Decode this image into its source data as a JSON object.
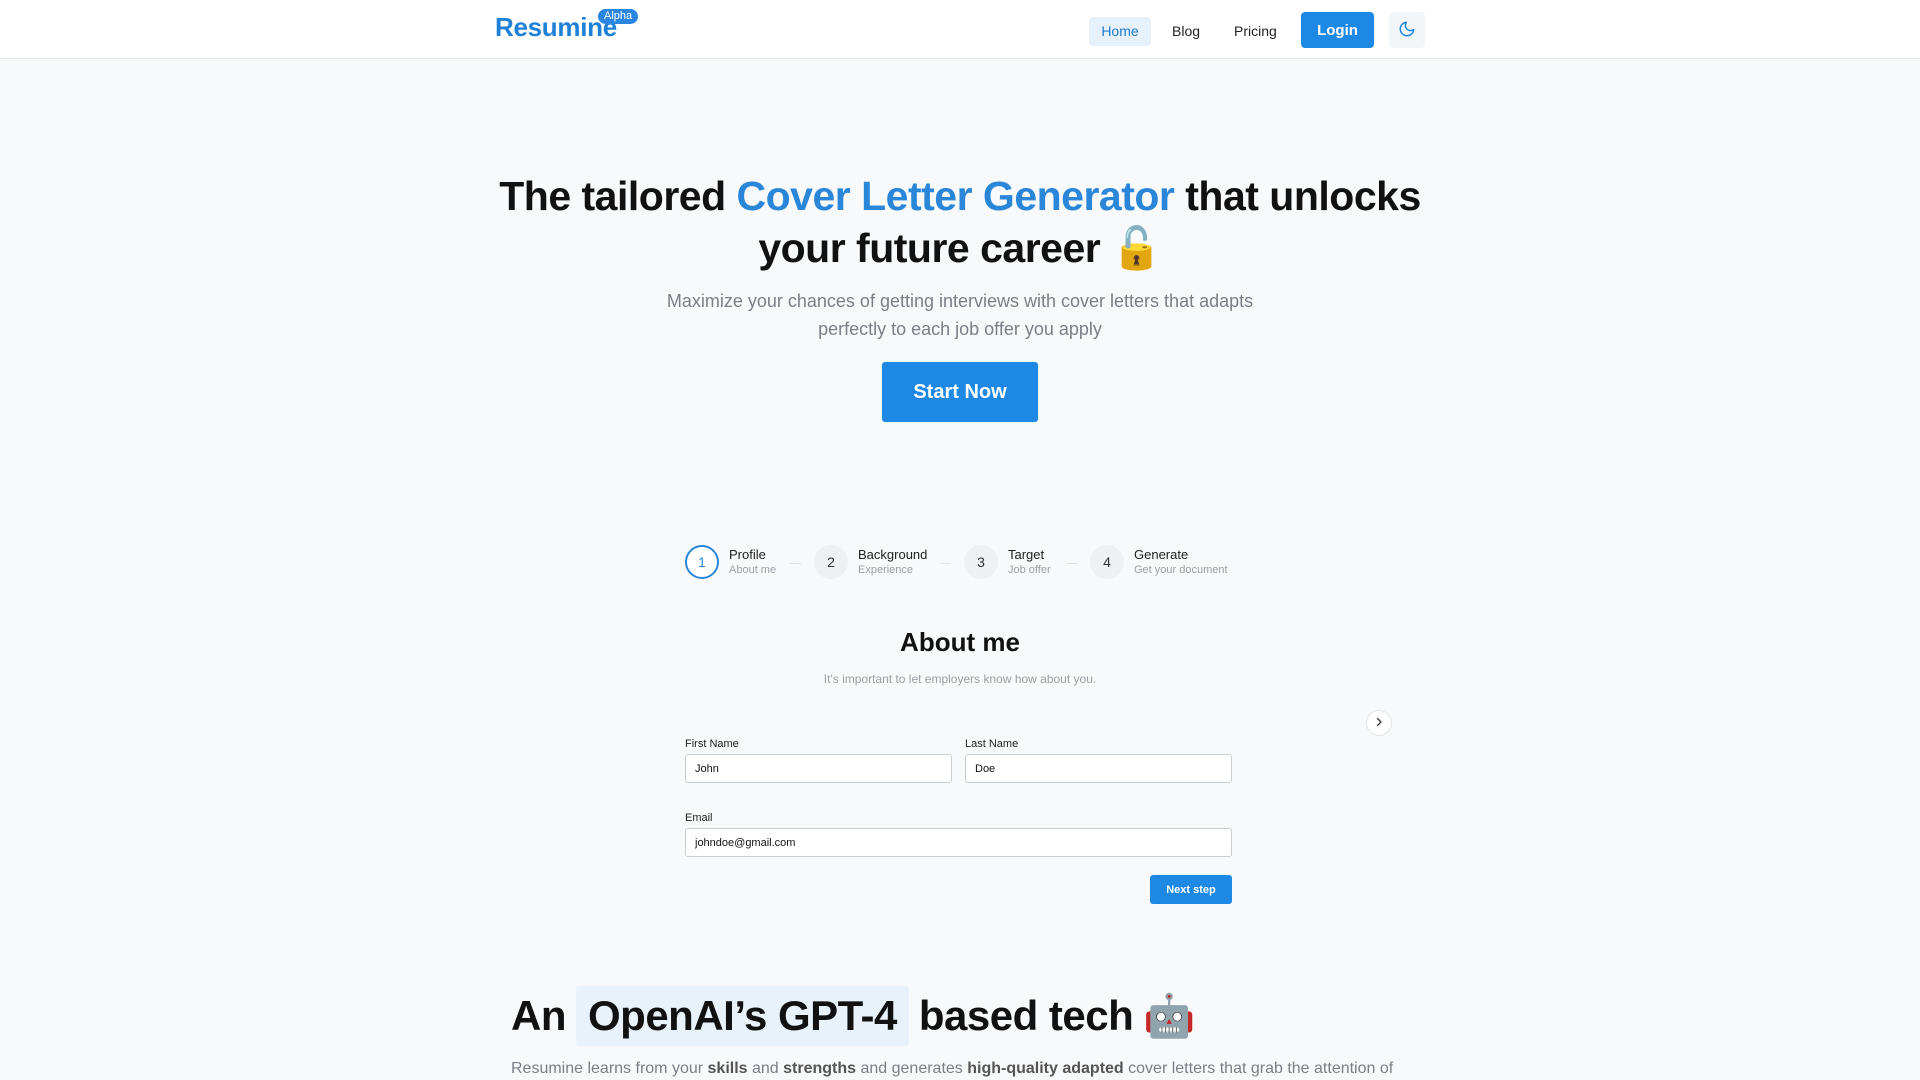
{
  "header": {
    "logo": "Resumine",
    "badge": "Alpha",
    "nav": {
      "home": "Home",
      "blog": "Blog",
      "pricing": "Pricing"
    },
    "login": "Login",
    "theme_icon": "moon-icon"
  },
  "hero": {
    "title_part1": "The tailored ",
    "title_accent": "Cover Letter Generator",
    "title_part2": " that unlocks your future career ",
    "title_emoji": "🔓",
    "subtitle": "Maximize your chances of getting interviews with cover letters that adapts perfectly to each job offer you apply",
    "cta": "Start Now"
  },
  "stepper": {
    "steps": [
      {
        "num": "1",
        "title": "Profile",
        "sub": "About me"
      },
      {
        "num": "2",
        "title": "Background",
        "sub": "Experience"
      },
      {
        "num": "3",
        "title": "Target",
        "sub": "Job offer"
      },
      {
        "num": "4",
        "title": "Generate",
        "sub": "Get your document"
      }
    ]
  },
  "form": {
    "title": "About me",
    "subtitle": "It's important to let employers know how about you.",
    "first_name_label": "First Name",
    "first_name_value": "John",
    "last_name_label": "Last Name",
    "last_name_value": "Doe",
    "email_label": "Email",
    "email_value": "johndoe@gmail.com",
    "next": "Next step"
  },
  "tech": {
    "title_pre": "An",
    "title_hl": "OpenAI’s GPT-4",
    "title_post": "based tech",
    "title_glyph": "🤖",
    "sub_1": "Resumine learns from your ",
    "sub_b1": "skills",
    "sub_2": " and ",
    "sub_b2": "strengths",
    "sub_3": " and generates ",
    "sub_b3": "high-quality adapted",
    "sub_4": " cover letters that grab the attention of"
  },
  "colors": {
    "accent": "#1e88e5",
    "accent_text": "#2a86d9"
  }
}
